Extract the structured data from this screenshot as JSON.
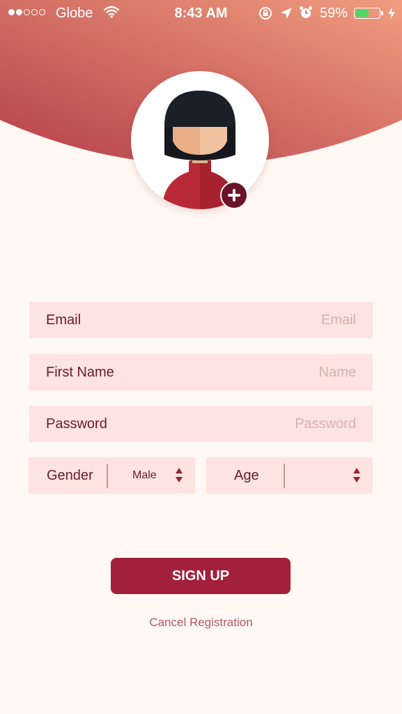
{
  "status_bar": {
    "carrier": "Globe",
    "time": "8:43 AM",
    "battery_percent": "59%",
    "battery_level": 0.59,
    "signal_strength": 2,
    "icons": [
      "wifi-icon",
      "orientation-lock-icon",
      "location-arrow-icon",
      "alarm-icon",
      "battery-icon",
      "charging-bolt-icon"
    ]
  },
  "avatar": {
    "icon": "female-avatar-icon",
    "add_icon": "plus-icon"
  },
  "form": {
    "email": {
      "label": "Email",
      "placeholder": "Email",
      "value": ""
    },
    "first_name": {
      "label": "First Name",
      "placeholder": "Name",
      "value": ""
    },
    "password": {
      "label": "Password",
      "placeholder": "Password",
      "value": ""
    },
    "gender": {
      "label": "Gender",
      "value": "Male"
    },
    "age": {
      "label": "Age",
      "value": ""
    }
  },
  "actions": {
    "signup_label": "SIGN UP",
    "cancel_label": "Cancel Registration"
  },
  "colors": {
    "background": "#fff8f3",
    "header_gradient_start": "#b53f4a",
    "header_gradient_end": "#f09c7e",
    "field_background": "#fde4e0",
    "primary_button": "#a2203a",
    "label_text": "#6b1a2b",
    "placeholder_text": "#d7b2ae",
    "link_text": "#b35a65"
  }
}
